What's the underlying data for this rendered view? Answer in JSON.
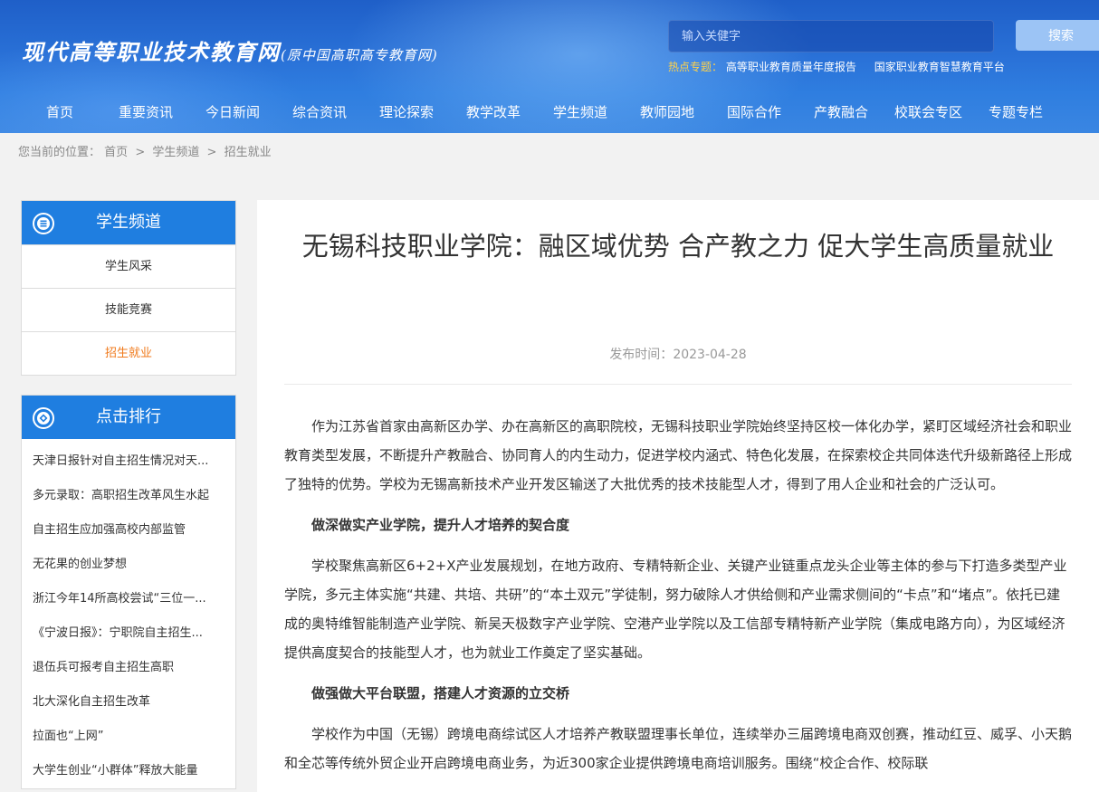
{
  "header": {
    "logo_main": "现代高等职业技术教育网",
    "logo_sub": "(原中国高职高专教育网)",
    "search": {
      "placeholder": "输入关健字",
      "button": "搜索"
    },
    "hot": {
      "label": "热点专题：",
      "links": [
        "高等职业教育质量年度报告",
        "国家职业教育智慧教育平台"
      ]
    },
    "nav": [
      "首页",
      "重要资讯",
      "今日新闻",
      "综合资讯",
      "理论探索",
      "教学改革",
      "学生频道",
      "教师园地",
      "国际合作",
      "产教融合",
      "校联会专区",
      "专题专栏"
    ]
  },
  "breadcrumb": {
    "prefix": "您当前的位置：",
    "items": [
      "首页",
      "学生频道",
      "招生就业"
    ],
    "separator": ">"
  },
  "sidebar": {
    "channel": {
      "title": "学生频道",
      "items": [
        "学生风采",
        "技能竞赛",
        "招生就业"
      ]
    },
    "ranking": {
      "title": "点击排行",
      "items": [
        "天津日报针对自主招生情况对天...",
        "多元录取：高职招生改革风生水起",
        "自主招生应加强高校内部监管",
        "无花果的创业梦想",
        "浙江今年14所高校尝试“三位一...",
        "《宁波日报》：宁职院自主招生...",
        "退伍兵可报考自主招生高职",
        "北大深化自主招生改革",
        "拉面也“上网”",
        "大学生创业“小群体”释放大能量"
      ]
    }
  },
  "article": {
    "title": "无锡科技职业学院：融区域优势 合产教之力 促大学生高质量就业",
    "meta_label": "发布时间：",
    "date": "2023-04-28",
    "paragraphs": [
      "作为江苏省首家由高新区办学、办在高新区的高职院校，无锡科技职业学院始终坚持区校一体化办学，紧盯区域经济社会和职业教育类型发展，不断提升产教融合、协同育人的内生动力，促进学校内涵式、特色化发展，在探索校企共同体迭代升级新路径上形成了独特的优势。学校为无锡高新技术产业开发区输送了大批优秀的技术技能型人才，得到了用人企业和社会的广泛认可。",
      "做深做实产业学院，提升人才培养的契合度",
      "学校聚焦高新区6+2+X产业发展规划，在地方政府、专精特新企业、关键产业链重点龙头企业等主体的参与下打造多类型产业学院，多元主体实施“共建、共培、共研”的“本土双元”学徒制，努力破除人才供给侧和产业需求侧间的“卡点”和“堵点”。依托已建成的奥特维智能制造产业学院、新吴天极数字产业学院、空港产业学院以及工信部专精特新产业学院（集成电路方向），为区域经济提供高度契合的技能型人才，也为就业工作奠定了坚实基础。",
      "做强做大平台联盟，搭建人才资源的立交桥",
      "学校作为中国（无锡）跨境电商综试区人才培养产教联盟理事长单位，连续举办三届跨境电商双创赛，推动红豆、威孚、小天鹅和全芯等传统外贸企业开启跨境电商业务，为近300家企业提供跨境电商培训服务。围绕“校企合作、校际联"
    ]
  }
}
